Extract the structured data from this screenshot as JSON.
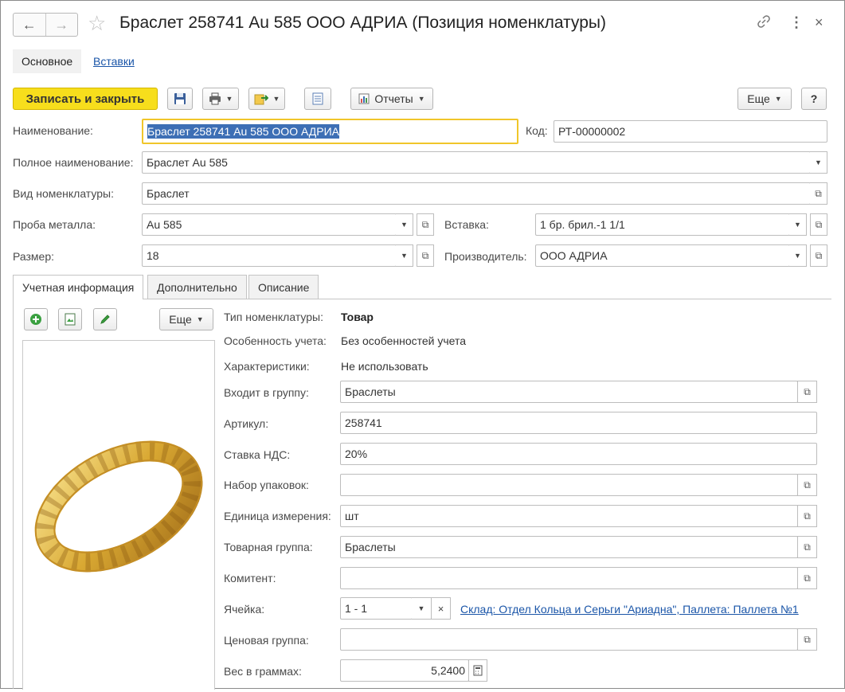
{
  "header": {
    "title": "Браслет 258741 Au 585 ООО АДРИА (Позиция номенклатуры)",
    "back_icon": "←",
    "forward_icon": "→",
    "star_icon": "☆",
    "link_icon": "🔗",
    "more_icon": "⋮",
    "close_icon": "×"
  },
  "top_tabs": {
    "main": "Основное",
    "inserts": "Вставки"
  },
  "toolbar": {
    "save_close": "Записать и закрыть",
    "reports": "Отчеты",
    "more": "Еще",
    "help": "?"
  },
  "form": {
    "name_label": "Наименование:",
    "name_value": "Браслет 258741 Au 585 ООО АДРИА",
    "code_label": "Код:",
    "code_value": "РТ-00000002",
    "fullname_label": "Полное наименование:",
    "fullname_value": "Браслет Au 585",
    "kind_label": "Вид номенклатуры:",
    "kind_value": "Браслет",
    "probe_label": "Проба металла:",
    "probe_value": "Au 585",
    "insert_label": "Вставка:",
    "insert_value": "1 бр. брил.-1 1/1",
    "size_label": "Размер:",
    "size_value": "18",
    "maker_label": "Производитель:",
    "maker_value": "ООО АДРИА"
  },
  "inner_tabs": [
    "Учетная информация",
    "Дополнительно",
    "Описание"
  ],
  "image_panel": {
    "more": "Еще"
  },
  "details": {
    "type_label": "Тип номенклатуры:",
    "type_value": "Товар",
    "feature_label": "Особенность учета:",
    "feature_value": "Без особенностей учета",
    "chars_label": "Характеристики:",
    "chars_value": "Не использовать",
    "group_label": "Входит в группу:",
    "group_value": "Браслеты",
    "article_label": "Артикул:",
    "article_value": "258741",
    "vat_label": "Ставка НДС:",
    "vat_value": "20%",
    "pack_label": "Набор упаковок:",
    "pack_value": "",
    "unit_label": "Единица измерения:",
    "unit_value": "шт",
    "goods_group_label": "Товарная группа:",
    "goods_group_value": "Браслеты",
    "committent_label": "Комитент:",
    "committent_value": "",
    "cell_label": "Ячейка:",
    "cell_value": "1 - 1",
    "cell_link": "Склад: Отдел Кольца и Серьги \"Ариадна\", Паллета: Паллета №1",
    "price_group_label": "Ценовая группа:",
    "price_group_value": "",
    "weight_label": "Вес в граммах:",
    "weight_value": "5,2400"
  },
  "colors": {
    "primary_button": "#f7de1c",
    "selection": "#3d6fb5",
    "link": "#1a55a8",
    "focus_border": "#f0c62a"
  }
}
